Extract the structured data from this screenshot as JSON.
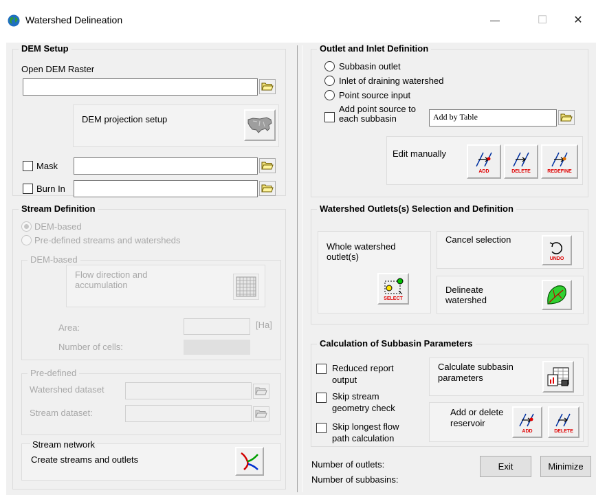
{
  "window": {
    "title": "Watershed Delineation",
    "minimize": "—",
    "maximize": "☐",
    "close": "✕"
  },
  "dem_setup": {
    "title": "DEM Setup",
    "open_dem_label": "Open DEM Raster",
    "open_dem_value": "",
    "projection_label": "DEM projection setup",
    "mask_label": "Mask",
    "mask_value": "",
    "burn_in_label": "Burn In",
    "burn_in_value": ""
  },
  "stream_definition": {
    "title": "Stream Definition",
    "radio_dem": "DEM-based",
    "radio_predefined": "Pre-defined streams and watersheds",
    "dem_based_title": "DEM-based",
    "flow_label": "Flow direction and accumulation",
    "area_label": "Area:",
    "area_unit": "[Ha]",
    "cells_label": "Number of cells:",
    "predefined_title": "Pre-defined",
    "watershed_dataset_label": "Watershed dataset",
    "stream_dataset_label": "Stream dataset:",
    "stream_network_title": "Stream network",
    "create_streams_label": "Create streams and outlets"
  },
  "outlet_inlet": {
    "title": "Outlet and Inlet Definition",
    "radio_subbasin": "Subbasin outlet",
    "radio_inlet": "Inlet of draining watershed",
    "radio_point": "Point source input",
    "add_point_source_label": "Add point source to each subbasin",
    "add_by_table_value": "Add by Table",
    "edit_manually_label": "Edit manually",
    "btn_add_caption": "ADD",
    "btn_delete_caption": "DELETE",
    "btn_redefine_caption": "REDEFINE"
  },
  "outlets_selection": {
    "title": "Watershed Outlets(s) Selection and Definition",
    "whole_watershed_label": "Whole watershed outlet(s)",
    "select_caption": "SELECT",
    "cancel_selection_label": "Cancel selection",
    "undo_caption": "UNDO",
    "delineate_label": "Delineate watershed"
  },
  "subbasin_params": {
    "title": "Calculation of Subbasin Parameters",
    "reduced_report_label": "Reduced report output",
    "skip_stream_label": "Skip stream geometry check",
    "skip_longest_label": "Skip longest flow path calculation",
    "calculate_label": "Calculate subbasin parameters",
    "reservoir_label": "Add or delete reservoir",
    "add_caption": "ADD",
    "delete_caption": "DELETE"
  },
  "footer": {
    "outlets_label": "Number of outlets:",
    "subbasins_label": "Number of subbasins:",
    "exit_label": "Exit",
    "minimize_label": "Minimize"
  },
  "icons": [
    "globe-icon",
    "folder-open-icon",
    "us-map-icon",
    "grid-icon",
    "stream-network-icon",
    "add-point-icon",
    "delete-point-icon",
    "redefine-point-icon",
    "select-outlet-icon",
    "undo-icon",
    "leaf-watershed-icon",
    "calculate-table-icon",
    "add-reservoir-icon",
    "delete-reservoir-icon"
  ]
}
